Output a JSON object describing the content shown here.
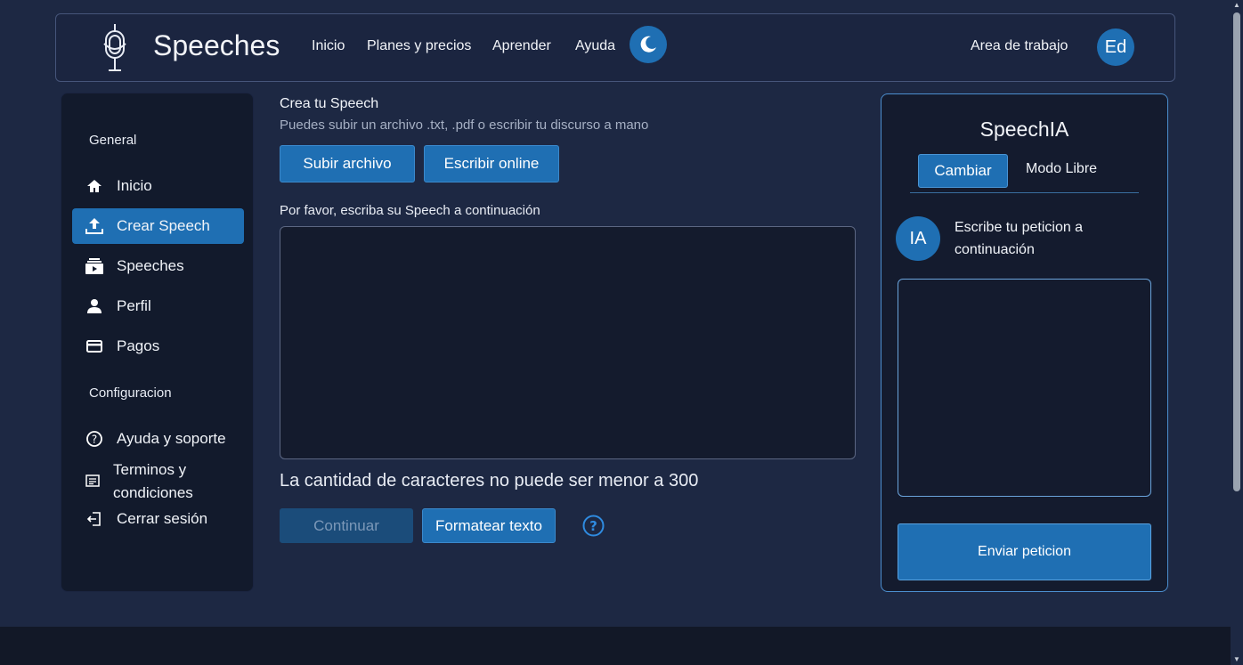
{
  "header": {
    "brand": "Speeches",
    "nav": [
      "Inicio",
      "Planes y precios",
      "Aprender",
      "Ayuda"
    ],
    "workspace_link": "Area de trabajo",
    "avatar_initials": "Ed"
  },
  "sidebar": {
    "general_heading": "General",
    "general_items": [
      {
        "label": "Inicio",
        "icon": "home-icon",
        "active": false
      },
      {
        "label": "Crear Speech",
        "icon": "upload-icon",
        "active": true
      },
      {
        "label": "Speeches",
        "icon": "video-library-icon",
        "active": false
      },
      {
        "label": "Perfil",
        "icon": "person-icon",
        "active": false
      },
      {
        "label": "Pagos",
        "icon": "credit-card-icon",
        "active": false
      }
    ],
    "config_heading": "Configuracion",
    "config_items": [
      {
        "label": "Ayuda y soporte",
        "icon": "help-icon"
      },
      {
        "label": "Terminos y condiciones",
        "icon": "document-icon"
      },
      {
        "label": "Cerrar sesión",
        "icon": "logout-icon"
      }
    ]
  },
  "main": {
    "title": "Crea tu Speech",
    "subtitle": "Puedes subir un archivo .txt, .pdf o escribir tu discurso a mano",
    "upload_button": "Subir archivo",
    "write_button": "Escribir online",
    "prompt_label": "Por favor, escriba su Speech a continuación",
    "speech_text": "",
    "warning": "La cantidad de caracteres no puede ser menor a 300",
    "continue_button": "Continuar",
    "format_button": "Formatear texto"
  },
  "ia_panel": {
    "title": "SpeechIA",
    "tab_active": "Cambiar",
    "tab_other": "Modo Libre",
    "avatar": "IA",
    "message": "Escribe tu peticion a continuación",
    "request_text": "",
    "send_button": "Enviar peticion"
  },
  "colors": {
    "background": "#1d2843",
    "accent": "#1f6fb3",
    "panel": "#121a2c"
  }
}
